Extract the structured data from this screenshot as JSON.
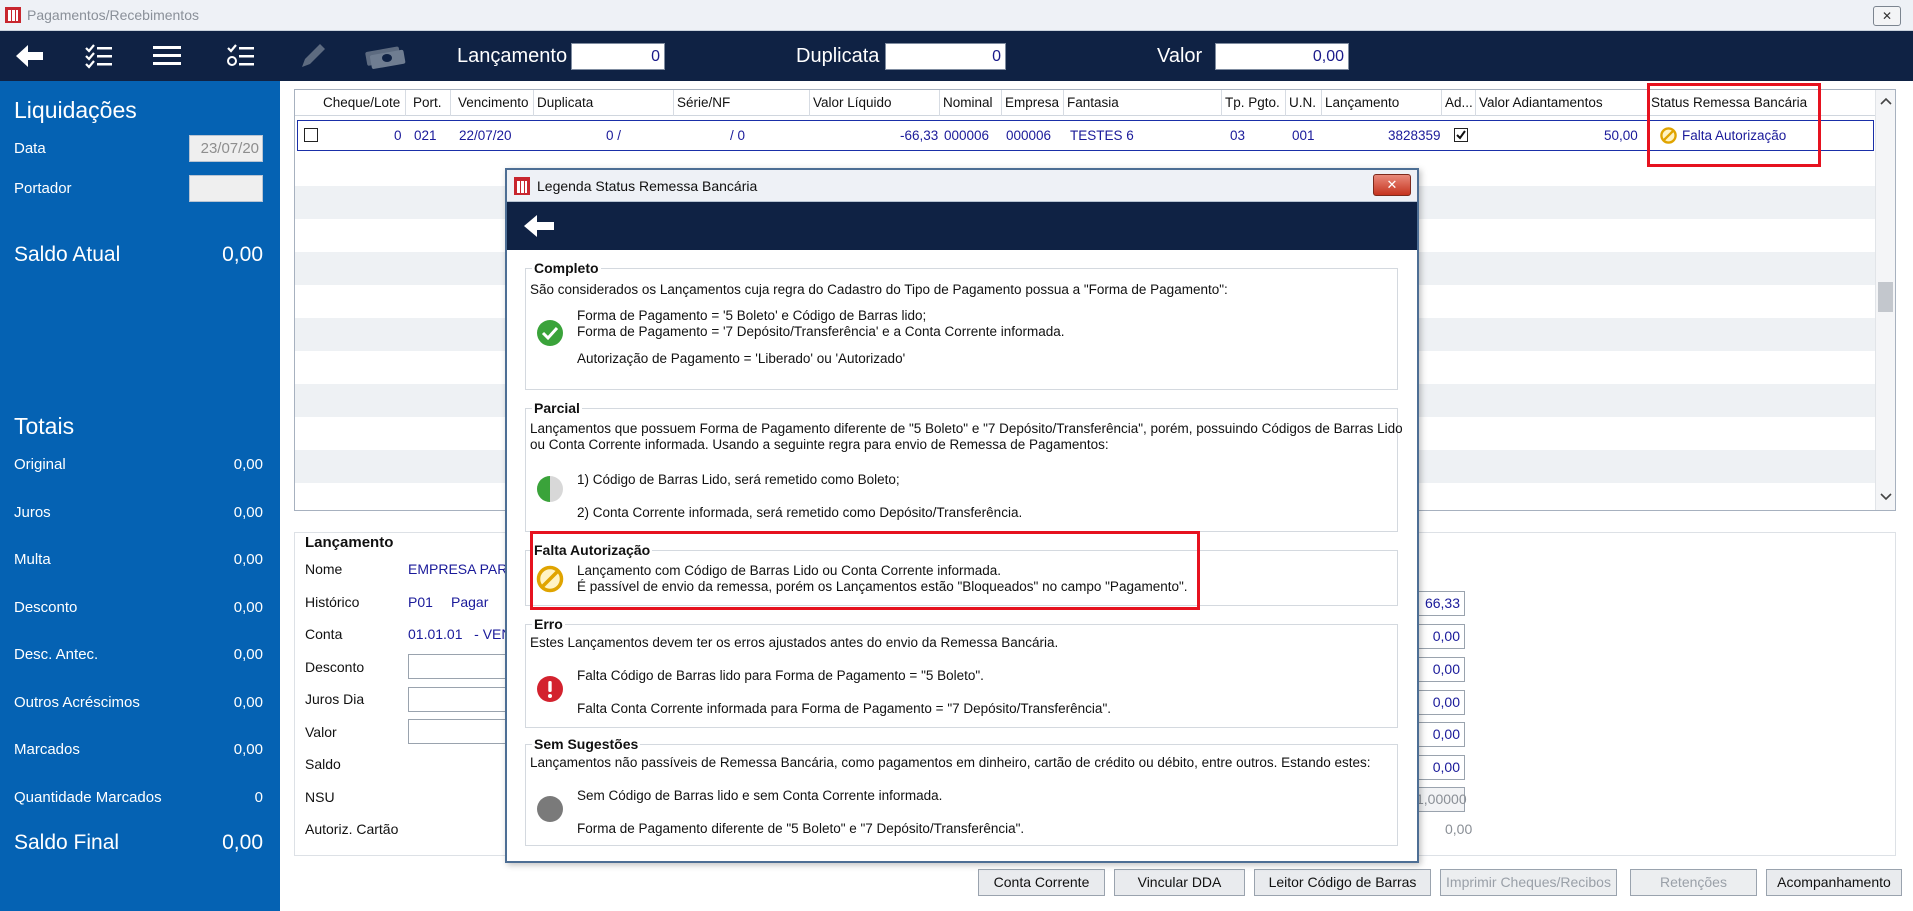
{
  "window": {
    "title": "Pagamentos/Recebimentos",
    "close": "✕"
  },
  "toolbar": {
    "lancamento_label": "Lançamento",
    "lancamento_value": "0",
    "duplicata_label": "Duplicata",
    "duplicata_value": "0",
    "valor_label": "Valor",
    "valor_value": "0,00"
  },
  "left": {
    "liquidacoes": "Liquidações",
    "data_label": "Data",
    "data_value": "23/07/20",
    "portador_label": "Portador",
    "saldo_atual_label": "Saldo Atual",
    "saldo_atual_value": "0,00",
    "totais": "Totais",
    "rows": [
      {
        "label": "Original",
        "value": "0,00"
      },
      {
        "label": "Juros",
        "value": "0,00"
      },
      {
        "label": "Multa",
        "value": "0,00"
      },
      {
        "label": "Desconto",
        "value": "0,00"
      },
      {
        "label": "Desc. Antec.",
        "value": "0,00"
      },
      {
        "label": "Outros Acréscimos",
        "value": "0,00"
      },
      {
        "label": "Marcados",
        "value": "0,00"
      },
      {
        "label": "Quantidade Marcados",
        "value": "0"
      }
    ],
    "saldo_final_label": "Saldo Final",
    "saldo_final_value": "0,00"
  },
  "grid": {
    "headers": [
      "Cheque/Lote",
      "Port.",
      "Vencimento",
      "Duplicata",
      "Série/NF",
      "Valor Líquido",
      "Nominal",
      "Empresa",
      "Fantasia",
      "Tp. Pgto.",
      "U.N.",
      "Lançamento",
      "Ad...",
      "Valor Adiantamentos",
      "Status Remessa Bancária"
    ],
    "row": {
      "cheque": "0",
      "port": "021",
      "vencimento": "22/07/20",
      "duplicata": "0 /",
      "serie": "/ 0",
      "valor_liquido": "-66,33",
      "nominal": "000006",
      "empresa": "000006",
      "fantasia": "TESTES 6",
      "tp_pgto": "03",
      "un": "001",
      "lancamento": "3828359",
      "valor_adiant": "50,00",
      "status": "Falta Autorização"
    }
  },
  "lancamento": {
    "title": "Lançamento",
    "nome_label": "Nome",
    "nome_value": "EMPRESA PARA",
    "historico_label": "Histórico",
    "historico_code": "P01",
    "historico_value": "Pagar",
    "conta_label": "Conta",
    "conta_value": "01.01.01   - VEN",
    "desconto_label": "Desconto",
    "juros_label": "Juros Dia",
    "valor_label": "Valor",
    "saldo_label": "Saldo",
    "nsu_label": "NSU",
    "autoriz_label": "Autoriz. Cartão",
    "right_values": [
      "66,33",
      "0,00",
      "0,00",
      "0,00",
      "0,00",
      "0,00",
      "1,00000",
      "0,00"
    ]
  },
  "buttons": {
    "conta_corrente": "Conta Corrente",
    "vincular_dda": "Vincular DDA",
    "leitor": "Leitor Código de Barras",
    "imprimir": "Imprimir Cheques/Recibos",
    "retencoes": "Retenções",
    "acompanhamento": "Acompanhamento"
  },
  "modal": {
    "title": "Legenda Status Remessa Bancária",
    "close": "✕",
    "completo": {
      "title": "Completo",
      "intro": "São considerados os Lançamentos cuja regra do Cadastro do Tipo de Pagamento possua a \"Forma de Pagamento\":",
      "l1": "Forma de Pagamento = '5 Boleto' e Código de Barras lido;",
      "l2": "Forma de Pagamento = '7 Depósito/Transferência' e a Conta Corrente informada.",
      "l3": "Autorização de Pagamento = 'Liberado' ou 'Autorizado'"
    },
    "parcial": {
      "title": "Parcial",
      "intro1": "Lançamentos que possuem Forma de Pagamento diferente de \"5 Boleto\" e \"7 Depósito/Transferência\", porém, possuindo Códigos de Barras Lido",
      "intro2": "ou Conta Corrente informada. Usando a seguinte regra para envio de Remessa de Pagamentos:",
      "l1": "1) Código de Barras Lido, será remetido como Boleto;",
      "l2": "2) Conta Corrente informada, será remetido como Depósito/Transferência."
    },
    "falta": {
      "title": "Falta Autorização",
      "l1": "Lançamento com Código de Barras Lido ou Conta Corrente informada.",
      "l2": "É passível de envio da remessa, porém os Lançamentos estão \"Bloqueados\" no campo \"Pagamento\"."
    },
    "erro": {
      "title": "Erro",
      "intro": "Estes Lançamentos devem ter os erros ajustados antes do envio da Remessa Bancária.",
      "l1": "Falta Código de Barras lido para Forma de Pagamento = \"5 Boleto\".",
      "l2": "Falta Conta Corrente informada para Forma de Pagamento = \"7 Depósito/Transferência\"."
    },
    "sem": {
      "title": "Sem Sugestões",
      "intro": "Lançamentos não passíveis de Remessa Bancária, como pagamentos em dinheiro, cartão de crédito ou débito, entre outros. Estando estes:",
      "l1": "Sem Código de Barras lido e sem Conta Corrente informada.",
      "l2": "Forma de Pagamento diferente de \"5 Boleto\" e \"7 Depósito/Transferência\"."
    }
  },
  "colors": {
    "toolbar": "#0f2244",
    "left_panel": "#0562b3",
    "highlight": "#e6121f",
    "ok": "#3aa33a",
    "warn": "#e0a400",
    "error": "#d3222e",
    "neutral": "#7a7a7a"
  }
}
